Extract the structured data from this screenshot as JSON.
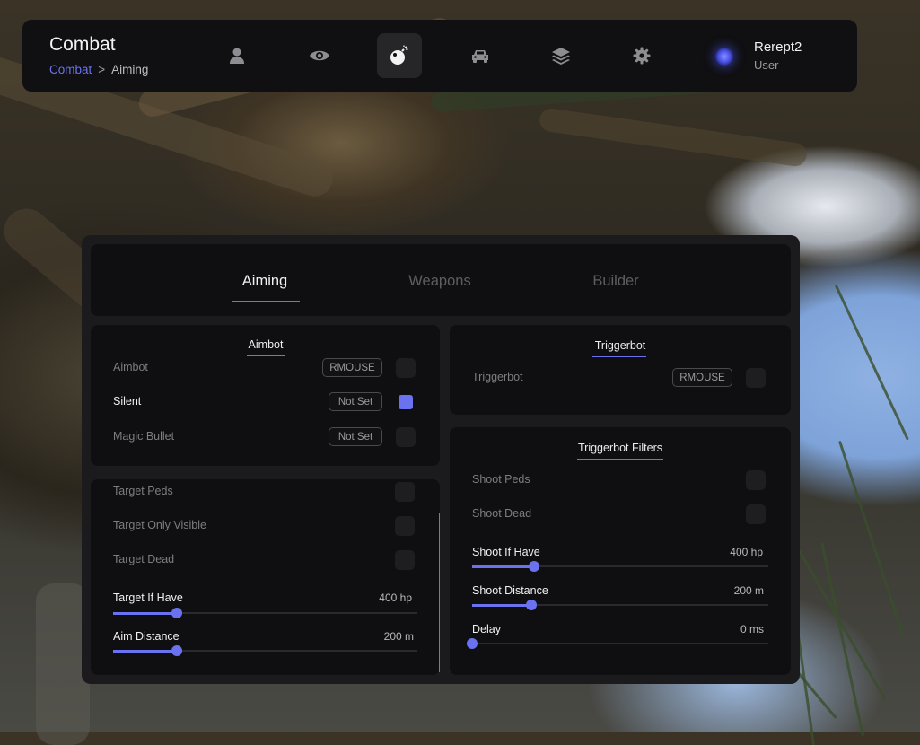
{
  "header": {
    "title": "Combat",
    "breadcrumb": [
      "Combat",
      "Aiming"
    ],
    "breadcrumb_sep": ">",
    "nav": [
      {
        "icon": "user-icon",
        "active": false
      },
      {
        "icon": "eye-icon",
        "active": false
      },
      {
        "icon": "bomb-icon",
        "active": true
      },
      {
        "icon": "car-icon",
        "active": false
      },
      {
        "icon": "layers-icon",
        "active": false
      },
      {
        "icon": "gear-icon",
        "active": false
      }
    ],
    "user": {
      "name": "Rerept2",
      "role": "User"
    }
  },
  "tabs": [
    {
      "label": "Aiming",
      "active": true
    },
    {
      "label": "Weapons",
      "active": false
    },
    {
      "label": "Builder",
      "active": false
    }
  ],
  "aimbot": {
    "title": "Aimbot",
    "rows": [
      {
        "label": "Aimbot",
        "key": "RMOUSE",
        "checked": false
      },
      {
        "label": "Silent",
        "key": "Not Set",
        "checked": true
      },
      {
        "label": "Magic Bullet",
        "key": "Not Set",
        "checked": false
      }
    ]
  },
  "targeting": {
    "toggles": [
      {
        "label": "Target Peds",
        "checked": false
      },
      {
        "label": "Target Only Visible",
        "checked": false
      },
      {
        "label": "Target Dead",
        "checked": false
      }
    ],
    "sliders": [
      {
        "label": "Target If Have",
        "value": "400 hp",
        "fraction": 0.21
      },
      {
        "label": "Aim Distance",
        "value": "200 m",
        "fraction": 0.21
      }
    ]
  },
  "triggerbot": {
    "title": "Triggerbot",
    "rows": [
      {
        "label": "Triggerbot",
        "key": "RMOUSE",
        "checked": false
      }
    ]
  },
  "triggerbot_filters": {
    "title": "Triggerbot Filters",
    "toggles": [
      {
        "label": "Shoot Peds",
        "checked": false
      },
      {
        "label": "Shoot Dead",
        "checked": false
      }
    ],
    "sliders": [
      {
        "label": "Shoot If Have",
        "value": "400 hp",
        "fraction": 0.21
      },
      {
        "label": "Shoot Distance",
        "value": "200 m",
        "fraction": 0.2
      },
      {
        "label": "Delay",
        "value": "0 ms",
        "fraction": 0.0
      }
    ]
  },
  "colors": {
    "accent": "#6b72f0",
    "panel": "#1b1b1d",
    "card": "#0f0f11"
  }
}
